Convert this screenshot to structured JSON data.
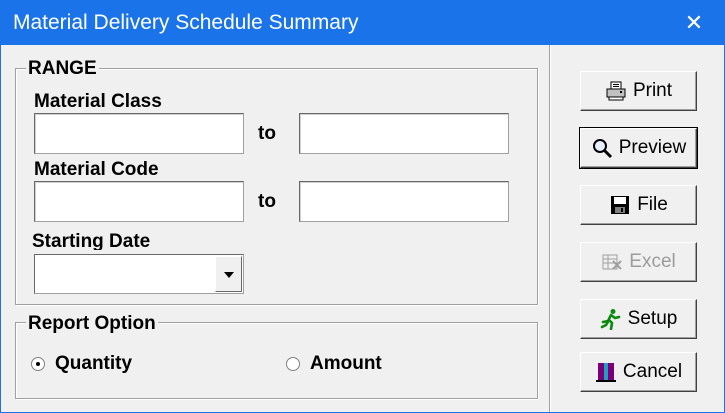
{
  "window": {
    "title": "Material Delivery Schedule Summary",
    "close_glyph": "✕"
  },
  "range": {
    "legend": "RANGE",
    "material_class": {
      "label": "Material Class",
      "from_value": "",
      "to_value": "",
      "to_label": "to"
    },
    "material_code": {
      "label": "Material Code",
      "from_value": "",
      "to_value": "",
      "to_label": "to"
    },
    "starting_date": {
      "label": "Starting Date",
      "selected": ""
    }
  },
  "report_option": {
    "legend": "Report Option",
    "options": [
      {
        "label": "Quantity",
        "checked": true
      },
      {
        "label": "Amount",
        "checked": false
      }
    ]
  },
  "buttons": {
    "print": "Print",
    "preview": "Preview",
    "file": "File",
    "excel": "Excel",
    "setup": "Setup",
    "cancel": "Cancel"
  },
  "icons": {
    "print": "printer-icon",
    "preview": "magnifier-icon",
    "file": "floppy-disk-icon",
    "excel": "spreadsheet-icon",
    "setup": "running-man-icon",
    "cancel": "exit-door-icon"
  },
  "colors": {
    "titlebar": "#1a73e8",
    "dialog_bg": "#f0f0f0",
    "disabled_text": "#9c9c9c"
  }
}
